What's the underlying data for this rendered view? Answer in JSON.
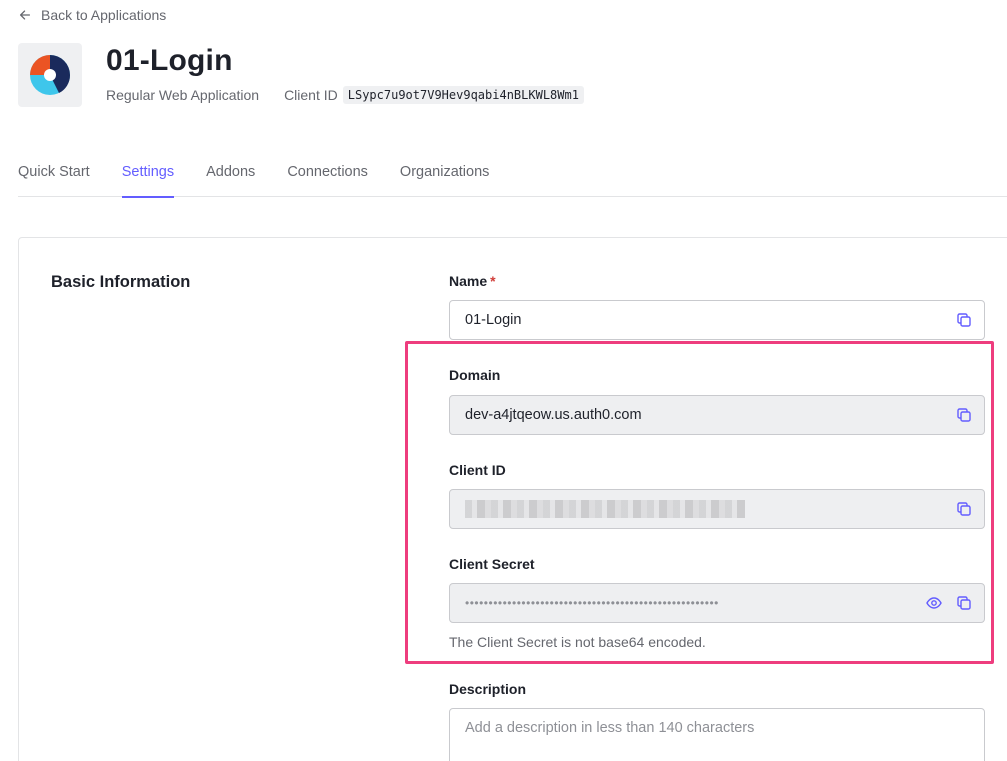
{
  "nav": {
    "back_label": "Back to Applications"
  },
  "app": {
    "title": "01-Login",
    "type": "Regular Web Application",
    "client_id_label": "Client ID",
    "client_id_value": "LSypc7u9ot7V9Hev9qabi4nBLKWL8Wm1"
  },
  "tabs": [
    {
      "label": "Quick Start"
    },
    {
      "label": "Settings"
    },
    {
      "label": "Addons"
    },
    {
      "label": "Connections"
    },
    {
      "label": "Organizations"
    }
  ],
  "settings": {
    "section_title": "Basic Information",
    "name": {
      "label": "Name",
      "required_mark": "*",
      "value": "01-Login"
    },
    "domain": {
      "label": "Domain",
      "value": "dev-a4jtqeow.us.auth0.com"
    },
    "client_id": {
      "label": "Client ID"
    },
    "client_secret": {
      "label": "Client Secret",
      "value": "••••••••••••••••••••••••••••••••••••••••••••••••••••••",
      "hint": "The Client Secret is not base64 encoded."
    },
    "description": {
      "label": "Description",
      "placeholder": "Add a description in less than 140 characters"
    }
  },
  "colors": {
    "accent": "#635dff",
    "highlight": "#ee3d7e",
    "required": "#d03c38"
  }
}
